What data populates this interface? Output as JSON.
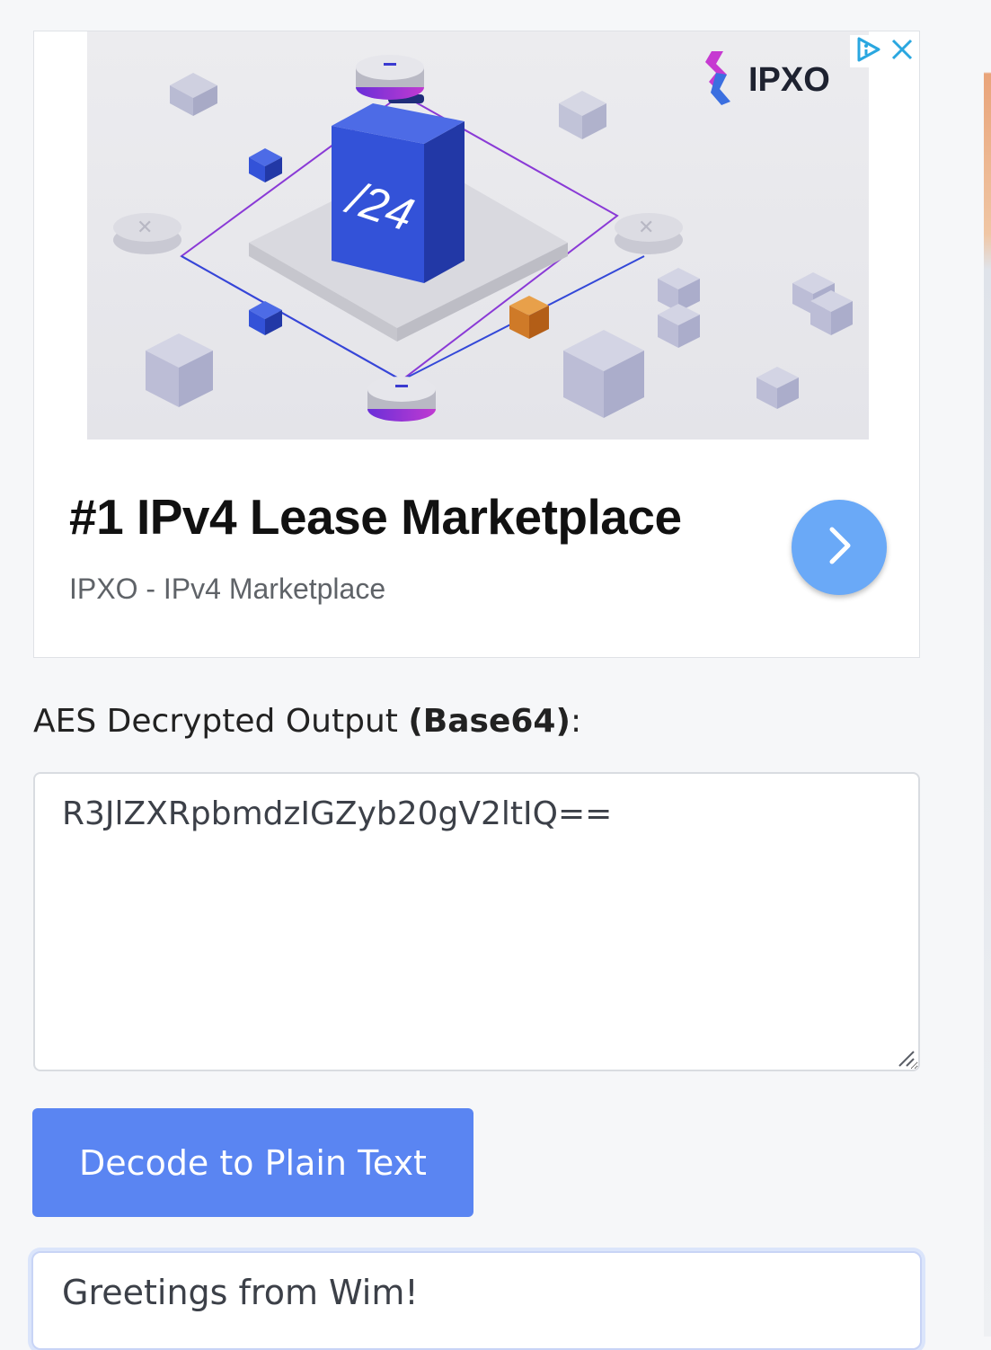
{
  "ad": {
    "headline": "#1 IPv4 Lease Marketplace",
    "source": "IPXO - IPv4 Marketplace",
    "brand_logo_text": "IPXO",
    "briefcase_text": "/24",
    "arrow_icon": "chevron-right-icon",
    "adchoices_icon": "adchoices-icon",
    "close_icon": "close-icon",
    "colors": {
      "arrow_button": "#6aa9f7",
      "brand_purple": "#7a2bd6",
      "briefcase_blue": "#3352d8"
    }
  },
  "output_section": {
    "label_prefix": "AES Decrypted Output ",
    "label_bold": "(Base64)",
    "label_suffix": ":",
    "value": "R3JlZXRpbmdzIGZyb20gV2ltIQ=="
  },
  "decode_button": {
    "label": "Decode to Plain Text",
    "color": "#5a85f2"
  },
  "plain_output": {
    "value": "Greetings from Wim!"
  }
}
